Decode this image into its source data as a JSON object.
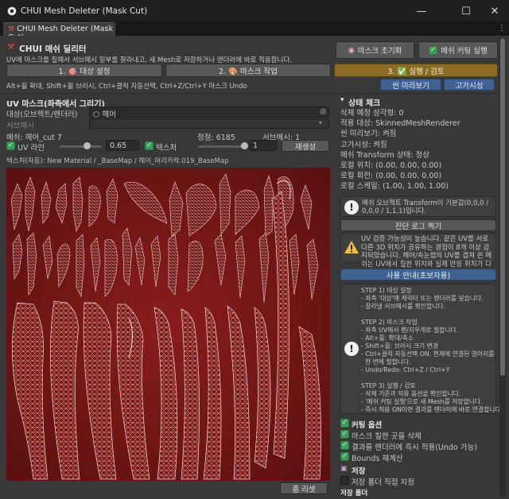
{
  "window": {
    "title": "CHUI Mesh Deleter (Mask Cut)",
    "minimize_glyph": "—",
    "maximize_glyph": "☐",
    "close_glyph": "✕"
  },
  "tab": {
    "label": "CHUI Mesh Deleter (Mask Cut)",
    "menu_glyph": "⋮"
  },
  "header": {
    "title": "CHUI 매쉬 딜리터",
    "desc": "UV에 마스크를 칠해서 서브메시 일부를 잘라내고, 새 Mesh로 저장하거나 렌더러에 바로 적용합니다.",
    "mask_reset": "마스크 초기화",
    "mesh_cut": "메쉬 커팅 실행",
    "hint": "Alt+휠 확대, Shift+휠 브러시, Ctrl+클릭 자동선택, Ctrl+Z/Ctrl+Y 마스크 Undo"
  },
  "steps": [
    {
      "label": "1. 🎯 대상 설정"
    },
    {
      "label": "2. 🎨 마스크 작업"
    },
    {
      "label": "3. ✅ 실행 / 검토"
    }
  ],
  "preview": {
    "scene": "씬 미리보기",
    "highlight": "고가시성"
  },
  "uv": {
    "section_title": "UV 마스크(좌측에서 그리기)",
    "target_label": "대상(오브젝트/렌더러)",
    "target_value": "헤어",
    "submesh_label": "서브메시",
    "submesh_value": "",
    "mesh_info": "메쉬: 헤어_cut 7",
    "vertex_info": "정점: 6185",
    "submesh_info": "서브메시: 1",
    "uvline_label": "UV 라인",
    "uvline_value": "0.65",
    "uvline_level": 0.65,
    "texture_label": "텍스처",
    "texture_value": "1",
    "texture_level": 1.0,
    "regen": "재생성",
    "texture_path": "텍스처(자동): New Material / _BaseMap / 헤어_머리카락.019_BaseMap",
    "zoom_reset": "줌 리셋"
  },
  "status": {
    "title": "상태 체크",
    "lines": [
      "삭제 예정 삼각형: 0",
      "적용 대상: SkinnedMeshRenderer",
      "씬 미리보기: 켜짐",
      "고가시성: 켜짐",
      "메쉬 Transform 상태: 정상",
      "로컬 위치: (0.00, 0.00, 0.00)",
      "로컬 회전: (0.00, 0.00, 0.00)",
      "로컬 스케일: (1.00, 1.00, 1.00)"
    ],
    "info_box": "메쉬 오브젝트 Transform이 기본값(0,0,0 / 0,0,0 / 1,1,1)입니다.",
    "diag_button": "진단 로그 찍기",
    "warn_box": "UV 검증 가능성이 높습니다. 같은 UV를 서로 다른 3D 위치가 공유하는 경점이 8개 이상 감지되었습니다. 헤어/속눈썹의 UV를 겹쳐 쓴 메쉬는 UV에서 칠한 위치와 실제 반응 위치가 다르게 보일 수 있습니다."
  },
  "guide": {
    "button": "사용 안내(초보자용)",
    "lines": [
      "STEP 1) 대상 설정",
      "- 좌측 '대상'에 캐릭터 또는 렌더러를 넣습니다.",
      "- 잘라낼 서브메시를 확인합니다.",
      "",
      "STEP 2) 마스크 작업",
      "- 좌측 UV에서 펜/지우개로 칠합니다.",
      "- Alt+휠: 확대/축소",
      "- Shift+휠: 브러시 크기 변경",
      "- Ctrl+클릭 자동선택 ON: 현재에 연결된 영어리를",
      "  한 번에 칠합니다.",
      "- Undo/Redo: Ctrl+Z / Ctrl+Y",
      "",
      "STEP 3) 실행 / 검토",
      "- 삭제 기준과 적용 옵션을 확인합니다.",
      "- '메쉬 커팅 실행'으로 새 Mesh를 저장합니다.",
      "- 즉시 적용 ON이면 결과를 렌더러에 바로 연결합니다."
    ]
  },
  "cut_options": {
    "title": "커팅 옵션",
    "items": [
      "마스크 칠한 곳을 삭제",
      "결과를 렌더러에 즉시 적용(Undo 가능)",
      "Bounds 재계산"
    ]
  },
  "save": {
    "title": "저장",
    "folder_option": "저장 폴더 직접 지정",
    "folder_label": "저장 폴더"
  },
  "colors": {
    "accent_orange": "#8b6a24",
    "accent_blue": "#3f6290",
    "check_green": "#3d9d5a",
    "mask_red": "#8a1d1d"
  }
}
